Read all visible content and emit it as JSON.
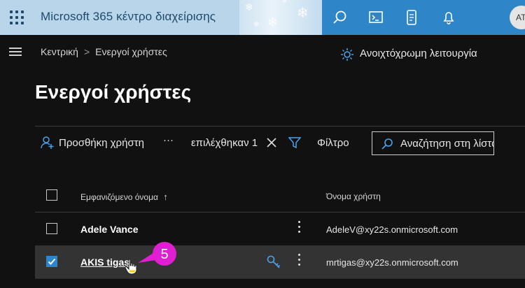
{
  "header": {
    "app_title": "Microsoft 365 κέντρο διαχείρισης",
    "avatar_initials": "AT",
    "icons": [
      "waffle-icon",
      "search-icon",
      "terminal-icon",
      "mobile-document-icon",
      "bell-icon"
    ]
  },
  "breadcrumb": {
    "home": "Κεντρική",
    "current": "Ενεργοί χρήστες"
  },
  "light_mode_label": "Ανοιχτόχρωμη λειτουργία",
  "page_title": "Ενεργοί χρήστες",
  "toolbar": {
    "add_user": "Προσθήκη χρήστη",
    "more": "···",
    "selected": "επιλέχθηκαν 1",
    "filter": "Φίλτρο",
    "search_placeholder": "Αναζήτηση στη λίστα"
  },
  "table": {
    "columns": {
      "display_name": "Εμφανιζόμενο όνομα",
      "sort_arrow": "↑",
      "username": "Όνομα χρήστη"
    },
    "rows": [
      {
        "name": "Adele Vance",
        "email": "AdeleV@xy22s.onmicrosoft.com",
        "checked": false
      },
      {
        "name": "AKIS tigas",
        "email": "mrtigas@xy22s.onmicrosoft.com",
        "checked": true
      }
    ]
  },
  "annotation": {
    "step": "5",
    "color": "#e11fd2"
  },
  "colors": {
    "accent": "#2e86c9",
    "background": "#111111"
  }
}
